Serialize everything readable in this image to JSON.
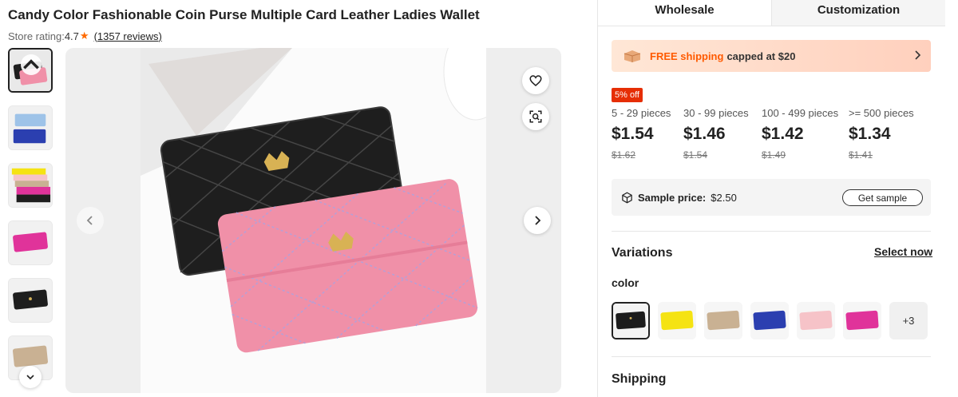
{
  "product": {
    "title": "Candy Color Fashionable Coin Purse Multiple Card Leather Ladies Wallet",
    "rating_label": "Store rating:",
    "rating_value": "4.7",
    "reviews": "(1357 reviews)"
  },
  "gallery": {
    "thumbnails": [
      "pink and black wallets",
      "blue wallets",
      "multicolor wallets",
      "magenta wallet",
      "black wallet",
      "beige wallet"
    ],
    "active_index": 0
  },
  "tabs": [
    {
      "label": "Wholesale",
      "active": true
    },
    {
      "label": "Customization",
      "active": false
    }
  ],
  "shipping_banner": {
    "free": "FREE shipping",
    "capped": "capped at $20"
  },
  "discount_badge": "5% off",
  "price_tiers": [
    {
      "range": "5 - 29 pieces",
      "price": "$1.54",
      "old_price": "$1.62"
    },
    {
      "range": "30 - 99 pieces",
      "price": "$1.46",
      "old_price": "$1.54"
    },
    {
      "range": "100 - 499 pieces",
      "price": "$1.42",
      "old_price": "$1.49"
    },
    {
      "range": ">= 500 pieces",
      "price": "$1.34",
      "old_price": "$1.41"
    }
  ],
  "sample": {
    "label": "Sample price:",
    "value": "$2.50",
    "button": "Get sample"
  },
  "variations": {
    "title": "Variations",
    "select_now": "Select now",
    "color_label": "color",
    "swatches": [
      {
        "name": "black",
        "color": "#1c1c1c"
      },
      {
        "name": "yellow",
        "color": "#f5e313"
      },
      {
        "name": "beige",
        "color": "#c9b193"
      },
      {
        "name": "blue",
        "color": "#2b3fb0"
      },
      {
        "name": "light pink",
        "color": "#f6c3c8"
      },
      {
        "name": "magenta",
        "color": "#e0339a"
      }
    ],
    "more": "+3"
  },
  "shipping_heading": "Shipping",
  "colors": {
    "accent": "#ff5a00",
    "badge": "#e62e04",
    "wallet_black": "#1e1e1e",
    "wallet_pink": "#f090a8"
  }
}
